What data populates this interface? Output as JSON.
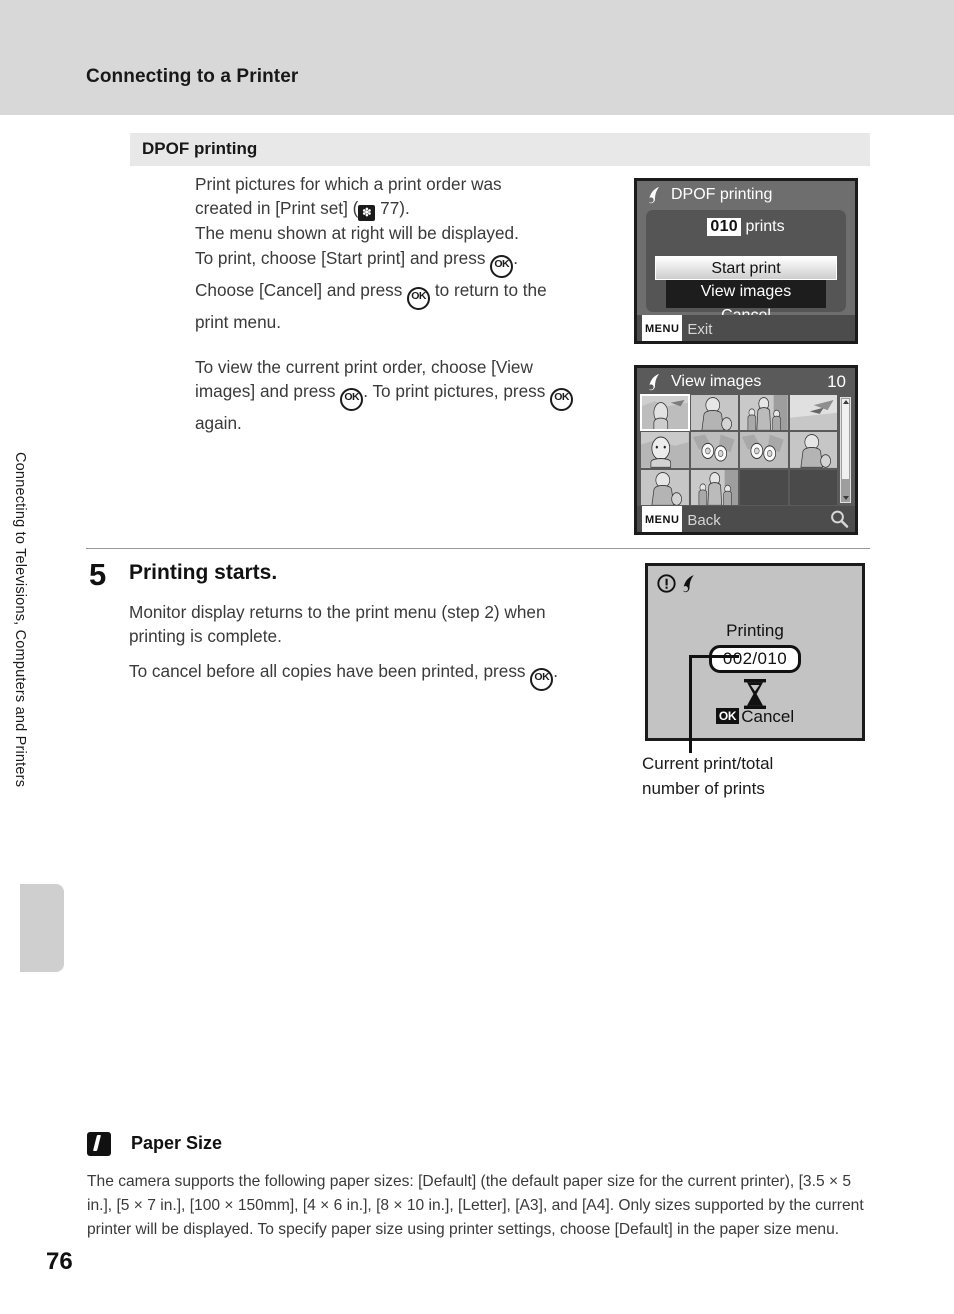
{
  "page": {
    "number": "76",
    "header_title": "Connecting to a Printer",
    "chapter_label": "Connecting to Televisions, Computers and Printers"
  },
  "section": {
    "band_title": "DPOF printing",
    "paragraph_1_a": "Print pictures for which a print order was\ncreated in [Print set] (",
    "paragraph_1_ref": "77).",
    "paragraph_1_b": "The menu shown at right will be displayed.\nTo print, choose [Start print] and press ",
    "paragraph_1_c": ".\nChoose [Cancel] and press ",
    "paragraph_1_d": " to return to the\nprint menu.",
    "paragraph_2_a": "To view the current print order, choose [View\nimages] and press ",
    "paragraph_2_b": ". To print pictures, press ",
    "paragraph_2_c": "\nagain."
  },
  "step5": {
    "number": "5",
    "title": "Printing starts.",
    "body_1": "Monitor display returns to the print menu (step 2) when\nprinting is complete.",
    "body_2_a": "To cancel before all copies have been printed, press ",
    "body_2_b": "."
  },
  "callout": {
    "caption": "Current print/total\nnumber of prints"
  },
  "screens": {
    "dpof": {
      "title": "DPOF printing",
      "count_value": "010",
      "count_label": "prints",
      "menu_items": [
        {
          "label": "Start print",
          "selected": true
        },
        {
          "label": "View images",
          "selected": false
        },
        {
          "label": "Cancel",
          "selected": false
        }
      ],
      "footer_badge": "MENU",
      "footer_label": "Exit"
    },
    "view_images": {
      "title": "View images",
      "count": "10",
      "thumbnail_count": 10,
      "grid_columns": 4,
      "grid_rows": 3,
      "selected_index": 0,
      "footer_badge": "MENU",
      "footer_label": "Back"
    },
    "printing": {
      "status_label": "Printing",
      "progress": "002/010",
      "current_print": 2,
      "total_prints": 10,
      "cancel_badge": "OK",
      "cancel_label": "Cancel"
    }
  },
  "note": {
    "title": "Paper Size",
    "body": "The camera supports the following paper sizes: [Default] (the default paper size for the current printer), [3.5 × 5 in.], [5 × 7 in.], [100 × 150mm], [4 × 6 in.], [8 × 10 in.], [Letter], [A3], and [A4]. Only sizes supported by the current printer will be displayed. To specify paper size using printer settings, choose [Default] in the paper size menu."
  },
  "glyphs": {
    "ok": "OK",
    "reference": "❇"
  },
  "colors": {
    "header_band": "#d8d8d8",
    "section_band": "#e8e8e8",
    "screen_border": "#1b1b1b",
    "tab_marker": "#cfcfcf"
  }
}
